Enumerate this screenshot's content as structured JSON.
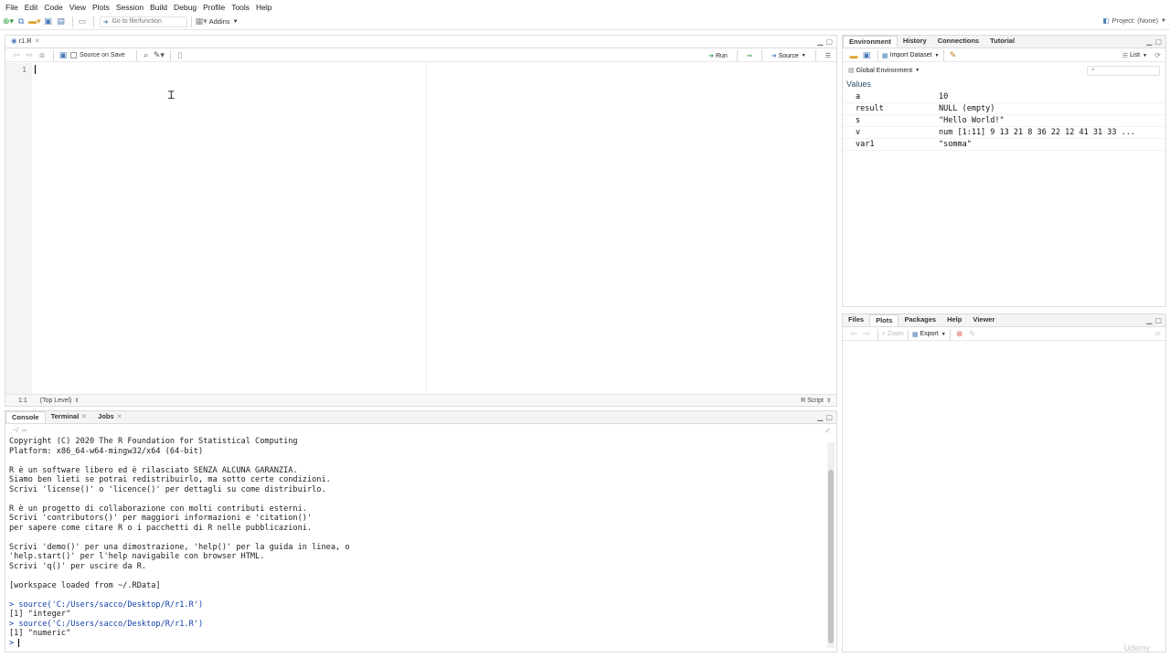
{
  "menu": [
    "File",
    "Edit",
    "Code",
    "View",
    "Plots",
    "Session",
    "Build",
    "Debug",
    "Profile",
    "Tools",
    "Help"
  ],
  "toolbar": {
    "goto_placeholder": "Go to file/function",
    "addins_label": "Addins",
    "project_label": "Project: (None)"
  },
  "editor": {
    "tab_label": "r1.R",
    "source_on_save_label": "Source on Save",
    "run_label": "Run",
    "source_label": "Source",
    "line_number": "1",
    "status_position": "1:1",
    "status_scope": "(Top Level)",
    "status_filetype": "R Script"
  },
  "console_pane": {
    "tabs": [
      "Console",
      "Terminal",
      "Jobs"
    ],
    "path": "~/",
    "lines": [
      "Copyright (C) 2020 The R Foundation for Statistical Computing",
      "Platform: x86_64-w64-mingw32/x64 (64-bit)",
      "",
      "R è un software libero ed è rilasciato SENZA ALCUNA GARANZIA.",
      "Siamo ben lieti se potrai redistribuirlo, ma sotto certe condizioni.",
      "Scrivi 'license()' o 'licence()' per dettagli su come distribuirlo.",
      "",
      "R è un progetto di collaborazione con molti contributi esterni.",
      "Scrivi 'contributors()' per maggiori informazioni e 'citation()'",
      "per sapere come citare R o i pacchetti di R nelle pubblicazioni.",
      "",
      "Scrivi 'demo()' per una dimostrazione, 'help()' per la guida in linea, o",
      "'help.start()' per l'help navigabile con browser HTML.",
      "Scrivi 'q()' per uscire da R.",
      "",
      "[workspace loaded from ~/.RData]",
      "",
      "> source('C:/Users/sacco/Desktop/R/r1.R')",
      "[1] \"integer\"",
      "> source('C:/Users/sacco/Desktop/R/r1.R')",
      "[1] \"numeric\"",
      "> "
    ]
  },
  "environment_pane": {
    "tabs": [
      "Environment",
      "History",
      "Connections",
      "Tutorial"
    ],
    "import_label": "Import Dataset",
    "list_label": "List",
    "scope_label": "Global Environment",
    "section_title": "Values",
    "values": [
      {
        "name": "a",
        "value": "10"
      },
      {
        "name": "result",
        "value": "NULL (empty)"
      },
      {
        "name": "s",
        "value": "\"Hello World!\""
      },
      {
        "name": "v",
        "value": "num [1:11] 9 13 21 8 36 22 12 41 31 33 ..."
      },
      {
        "name": "var1",
        "value": "\"somma\""
      }
    ]
  },
  "files_pane": {
    "tabs": [
      "Files",
      "Plots",
      "Packages",
      "Help",
      "Viewer"
    ],
    "zoom_label": "Zoom",
    "export_label": "Export"
  },
  "watermark": "Udemy",
  "colors": {
    "accent": "#4a7ab5",
    "command": "#0f3ea8"
  }
}
